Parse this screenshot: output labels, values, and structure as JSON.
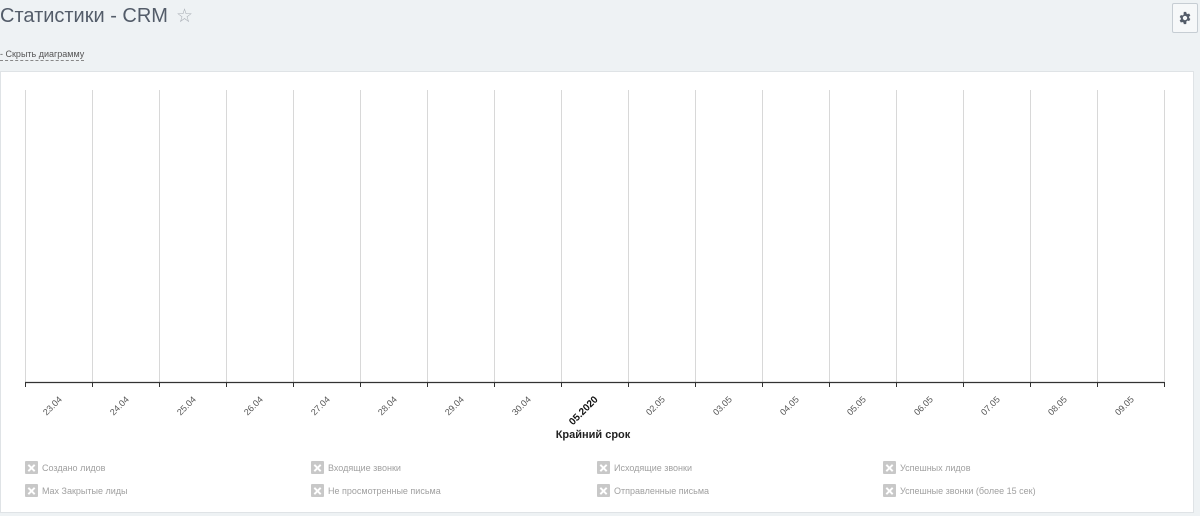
{
  "header": {
    "title": "Статистики - CRM",
    "star_icon": "star-outline-icon",
    "settings_icon": "gear-icon"
  },
  "toolbar": {
    "hide_chart_link": "- Скрыть диаграмму"
  },
  "chart_data": {
    "type": "line",
    "x": [
      "23.04",
      "24.04",
      "25.04",
      "26.04",
      "27.04",
      "28.04",
      "29.04",
      "30.04",
      "05.2020",
      "02.05",
      "03.05",
      "04.05",
      "05.05",
      "06.05",
      "07.05",
      "08.05",
      "09.05"
    ],
    "emphasized_tick": "05.2020",
    "xlabel": "Крайний срок",
    "ylabel": "",
    "grid": "vertical",
    "series": [
      {
        "name": "Создано лидов",
        "values": [],
        "visible": false
      },
      {
        "name": "Входящие звонки",
        "values": [],
        "visible": false
      },
      {
        "name": "Исходящие звонки",
        "values": [],
        "visible": false
      },
      {
        "name": "Успешных лидов",
        "values": [],
        "visible": false
      },
      {
        "name": "Max Закрытые лиды",
        "values": [],
        "visible": false
      },
      {
        "name": "Не просмотренные письма",
        "values": [],
        "visible": false
      },
      {
        "name": "Отправленные письма",
        "values": [],
        "visible": false
      },
      {
        "name": "Успешные звонки (более 15 сек)",
        "values": [],
        "visible": false
      }
    ],
    "legend_position": "bottom"
  },
  "legend": {
    "items": [
      "Создано лидов",
      "Входящие звонки",
      "Исходящие звонки",
      "Успешных лидов",
      "Max Закрытые лиды",
      "Не просмотренные письма",
      "Отправленные письма",
      "Успешные звонки (более 15 сек)"
    ],
    "toggle_icon": "checkbox-unchecked-icon"
  },
  "colors": {
    "background": "#eef2f4",
    "panel": "#ffffff",
    "gridline": "#d8d8d8",
    "axis": "#333333",
    "legend_disabled": "#c8c8c8"
  }
}
